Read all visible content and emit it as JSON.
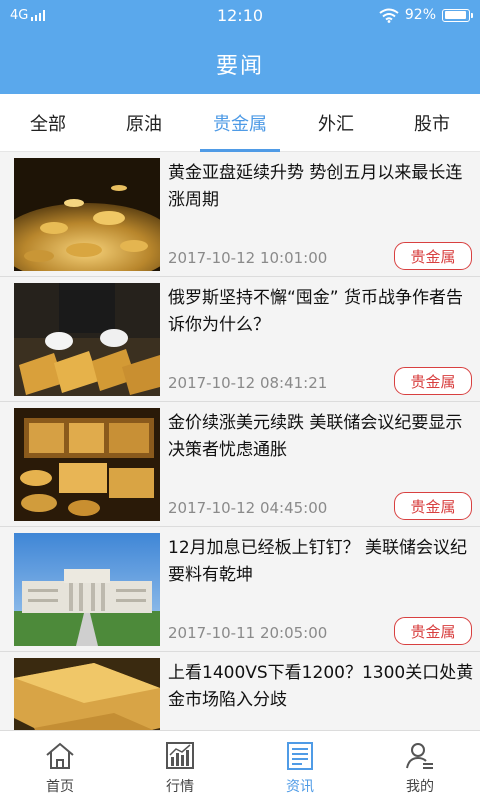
{
  "status": {
    "network": "4G",
    "time": "12:10",
    "battery": "92%",
    "battery_level": 0.92
  },
  "header": {
    "title": "要闻"
  },
  "tabs": [
    {
      "label": "全部"
    },
    {
      "label": "原油"
    },
    {
      "label": "贵金属"
    },
    {
      "label": "外汇"
    },
    {
      "label": "股市"
    }
  ],
  "active_tab": "贵金属",
  "news": [
    {
      "title": "黄金亚盘延续升势 势创五月以来最长连涨周期",
      "time": "2017-10-12 10:01:00",
      "tag": "贵金属"
    },
    {
      "title": "俄罗斯坚持不懈“囤金” 货币战争作者告诉你为什么？",
      "time": "2017-10-12 08:41:21",
      "tag": "贵金属"
    },
    {
      "title": "金价续涨美元续跌 美联储会议纪要显示决策者忧虑通胀",
      "time": "2017-10-12 04:45:00",
      "tag": "贵金属"
    },
    {
      "title": "12月加息已经板上钉钉？ 美联储会议纪要料有乾坤",
      "time": "2017-10-11 20:05:00",
      "tag": "贵金属"
    },
    {
      "title": "上看1400VS下看1200？1300关口处黄金市场陷入分歧"
    }
  ],
  "bottom_nav": [
    {
      "label": "首页",
      "icon": "home-icon"
    },
    {
      "label": "行情",
      "icon": "chart-icon"
    },
    {
      "label": "资讯",
      "icon": "news-icon"
    },
    {
      "label": "我的",
      "icon": "profile-icon"
    }
  ],
  "colors": {
    "header": "#5aa8ec",
    "accent": "#4f9be6",
    "tag": "#d84040"
  }
}
